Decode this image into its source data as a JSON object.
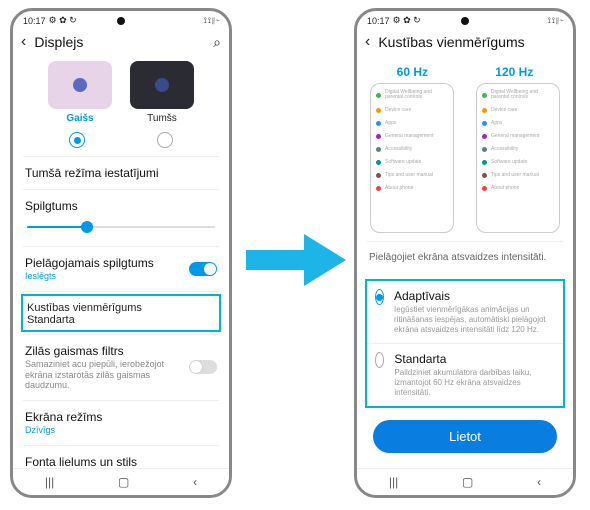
{
  "status": {
    "time": "10:17",
    "right": "⟟ ⟟ ∥ ⌁"
  },
  "left": {
    "title": "Displejs",
    "themes": {
      "light": "Gaišs",
      "dark": "Tumšs"
    },
    "dark_settings": "Tumšā režīma iestatījumi",
    "brightness": "Spilgtums",
    "adaptive_brightness": {
      "label": "Pielāgojamais spilgtums",
      "status": "Ieslēgts"
    },
    "motion": {
      "label": "Kustības vienmērīgums",
      "status": "Standarta"
    },
    "bluelight": {
      "label": "Zilās gaismas filtrs",
      "desc": "Samaziniet acu piepūli, ierobežojot ekrāna izstarotās zilās gaismas daudzumu."
    },
    "screen_mode": {
      "label": "Ekrāna režīms",
      "status": "Dzīvīgs"
    },
    "font": "Fonta lielums un stils"
  },
  "right": {
    "title": "Kustības vienmērīgums",
    "hz1": "60 Hz",
    "hz2": "120 Hz",
    "mini_items": [
      "Digital Wellbeing and parental controls",
      "Device care",
      "Apps",
      "General management",
      "Accessibility",
      "Software update",
      "Tips and user manual",
      "About phone"
    ],
    "caption": "Pielāgojiet ekrāna atsvaidzes intensitāti.",
    "opt1": {
      "label": "Adaptīvais",
      "desc": "Iegūstiet vienmērīgākas animācijas un ritināšanas iespējas, automātiski pielāgojot ekrāna atsvaidzes intensitāti līdz 120 Hz."
    },
    "opt2": {
      "label": "Standarta",
      "desc": "Paildziniet akumulatora darbības laiku, izmantojot 60 Hz ekrāna atsvaidzes intensitāti."
    },
    "apply": "Lietot"
  }
}
